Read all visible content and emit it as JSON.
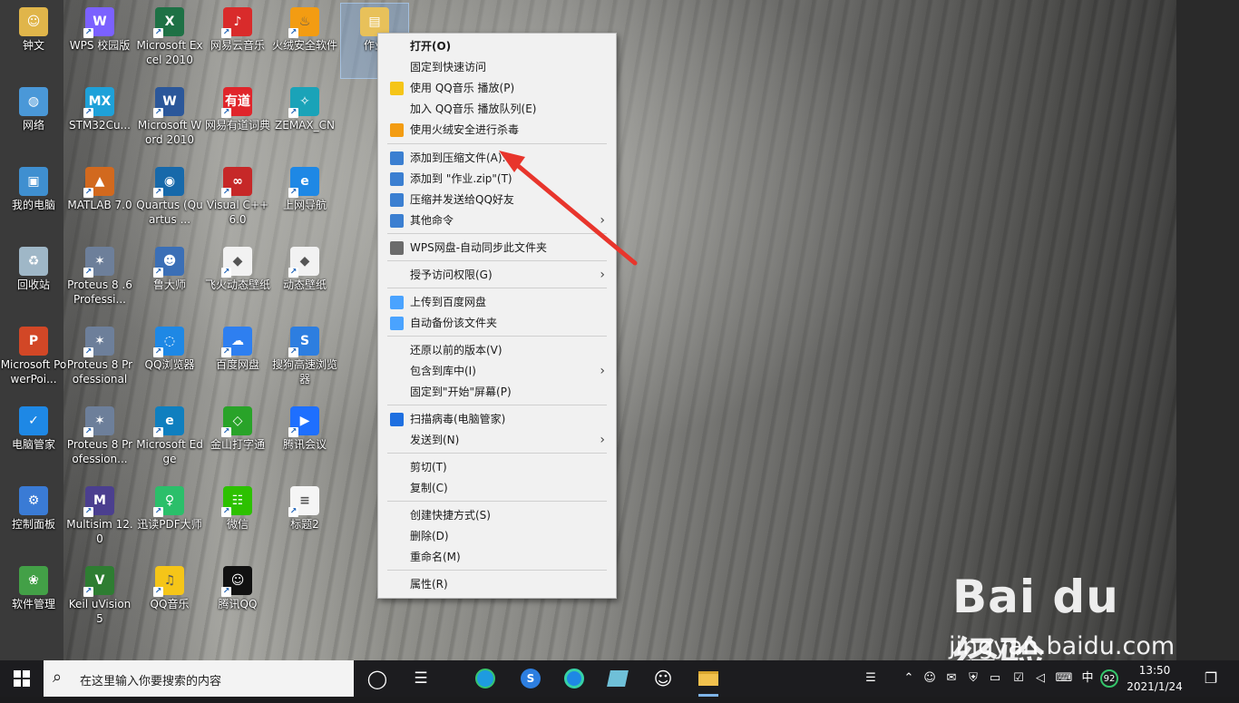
{
  "desktop_icons": [
    {
      "label": "钟文",
      "glyph": "☺",
      "color": "#e0b54a"
    },
    {
      "label": "网络",
      "glyph": "◍",
      "color": "#4a98d8"
    },
    {
      "label": "我的电脑",
      "glyph": "▣",
      "color": "#3f8fd0"
    },
    {
      "label": "回收站",
      "glyph": "♻",
      "color": "#9fb7c7"
    },
    {
      "label": "Microsoft PowerPoi...",
      "glyph": "P",
      "color": "#d24726"
    },
    {
      "label": "电脑管家",
      "glyph": "✓",
      "color": "#1e88e5"
    },
    {
      "label": "控制面板",
      "glyph": "⚙",
      "color": "#3a7bd5"
    },
    {
      "label": "软件管理",
      "glyph": "❀",
      "color": "#43a047"
    },
    {
      "label": "WPS 校园版",
      "glyph": "W",
      "color": "#7b61ff"
    },
    {
      "label": "STM32Cu...",
      "glyph": "MX",
      "color": "#1ea1d9"
    },
    {
      "label": "MATLAB 7.0",
      "glyph": "▲",
      "color": "#d2691e"
    },
    {
      "label": "Proteus 8 .6Professi...",
      "glyph": "✶",
      "color": "#6d7f9a"
    },
    {
      "label": "Proteus 8 Professional",
      "glyph": "✶",
      "color": "#6d7f9a"
    },
    {
      "label": "Proteus 8 Profession...",
      "glyph": "✶",
      "color": "#6d7f9a"
    },
    {
      "label": "Multisim 12.0",
      "glyph": "M",
      "color": "#4b3f8f"
    },
    {
      "label": "Keil uVision5",
      "glyph": "V",
      "color": "#2e7d32"
    },
    {
      "label": "Microsoft Excel 2010",
      "glyph": "X",
      "color": "#1e7145"
    },
    {
      "label": "Microsoft Word 2010",
      "glyph": "W",
      "color": "#2b579a"
    },
    {
      "label": "Quartus (Quartus ...",
      "glyph": "◉",
      "color": "#1769aa"
    },
    {
      "label": "鲁大师",
      "glyph": "☻",
      "color": "#3b6fb6"
    },
    {
      "label": "QQ浏览器",
      "glyph": "◌",
      "color": "#1e88e5"
    },
    {
      "label": "Microsoft Edge",
      "glyph": "e",
      "color": "#0f7fbf"
    },
    {
      "label": "迅读PDF大师",
      "glyph": "♀",
      "color": "#2bbf6a"
    },
    {
      "label": "QQ音乐",
      "glyph": "♫",
      "color": "#f5c518"
    },
    {
      "label": "网易云音乐",
      "glyph": "♪",
      "color": "#d92b2b"
    },
    {
      "label": "网易有道词典",
      "glyph": "有道",
      "color": "#e0252b"
    },
    {
      "label": "Visual C++ 6.0",
      "glyph": "∞",
      "color": "#c62828"
    },
    {
      "label": "飞火动态壁纸",
      "glyph": "◆",
      "color": "#f2f2f2"
    },
    {
      "label": "百度网盘",
      "glyph": "☁",
      "color": "#2e7ff0"
    },
    {
      "label": "金山打字通",
      "glyph": "◇",
      "color": "#29a329"
    },
    {
      "label": "微信",
      "glyph": "☷",
      "color": "#2dc100"
    },
    {
      "label": "腾讯QQ",
      "glyph": "☺",
      "color": "#111111"
    },
    {
      "label": "火绒安全软件",
      "glyph": "♨",
      "color": "#f39c12"
    },
    {
      "label": "ZEMAX_CN",
      "glyph": "✧",
      "color": "#1aa3b8"
    },
    {
      "label": "上网导航",
      "glyph": "e",
      "color": "#1e88e5"
    },
    {
      "label": "动态壁纸",
      "glyph": "◆",
      "color": "#f2f2f2"
    },
    {
      "label": "搜狗高速浏览器",
      "glyph": "S",
      "color": "#2d7ee0"
    },
    {
      "label": "腾讯会议",
      "glyph": "▶",
      "color": "#1e6fff"
    },
    {
      "label": "标题2",
      "glyph": "≡",
      "color": "#f5f5f5"
    },
    {
      "label": "作业",
      "glyph": "▤",
      "color": "#e8c15a"
    }
  ],
  "context_menu": {
    "items": [
      {
        "label": "打开(O)",
        "bold": true,
        "icon": "",
        "submenu": false
      },
      {
        "label": "固定到快速访问",
        "icon": "",
        "submenu": false
      },
      {
        "label": "使用 QQ音乐 播放(P)",
        "icon": "qq-music-icon",
        "icon_color": "#f5c518",
        "submenu": false
      },
      {
        "label": "加入 QQ音乐 播放队列(E)",
        "icon": "",
        "submenu": false
      },
      {
        "label": "使用火绒安全进行杀毒",
        "icon": "huorong-icon",
        "icon_color": "#f39c12",
        "submenu": false
      },
      {
        "label": "添加到压缩文件(A)...",
        "icon": "archive-icon",
        "icon_color": "#3b7fd1",
        "submenu": false
      },
      {
        "label": "添加到 \"作业.zip\"(T)",
        "icon": "archive-icon",
        "icon_color": "#3b7fd1",
        "submenu": false
      },
      {
        "label": "压缩并发送给QQ好友",
        "icon": "archive-icon",
        "icon_color": "#3b7fd1",
        "submenu": false
      },
      {
        "label": "其他命令",
        "icon": "archive-icon",
        "icon_color": "#3b7fd1",
        "submenu": true
      },
      {
        "label": "WPS网盘-自动同步此文件夹",
        "icon": "wps-cloud-icon",
        "icon_color": "#6b6b6b",
        "submenu": false
      },
      {
        "label": "授予访问权限(G)",
        "icon": "",
        "submenu": true
      },
      {
        "label": "上传到百度网盘",
        "icon": "baidu-cloud-icon",
        "icon_color": "#4aa3ff",
        "submenu": false
      },
      {
        "label": "自动备份该文件夹",
        "icon": "baidu-cloud-icon",
        "icon_color": "#4aa3ff",
        "submenu": false
      },
      {
        "label": "还原以前的版本(V)",
        "icon": "",
        "submenu": false
      },
      {
        "label": "包含到库中(I)",
        "icon": "",
        "submenu": true
      },
      {
        "label": "固定到\"开始\"屏幕(P)",
        "icon": "",
        "submenu": false
      },
      {
        "label": "扫描病毒(电脑管家)",
        "icon": "tencent-guard-icon",
        "icon_color": "#1e6fe0",
        "submenu": false
      },
      {
        "label": "发送到(N)",
        "icon": "",
        "submenu": true
      },
      {
        "label": "剪切(T)",
        "icon": "",
        "submenu": false
      },
      {
        "label": "复制(C)",
        "icon": "",
        "submenu": false
      },
      {
        "label": "创建快捷方式(S)",
        "icon": "",
        "submenu": false
      },
      {
        "label": "删除(D)",
        "icon": "",
        "submenu": false
      },
      {
        "label": "重命名(M)",
        "icon": "",
        "submenu": false
      },
      {
        "label": "属性(R)",
        "icon": "",
        "submenu": false
      }
    ]
  },
  "annotation": {
    "color": "#e8352c"
  },
  "watermark": {
    "logo": "Bai du 经验",
    "url": "jingyan.baidu.com"
  },
  "taskbar": {
    "search_placeholder": "在这里输入你要搜索的内容",
    "ime": "中",
    "badge": "92",
    "time": "13:50",
    "date": "2021/1/24"
  }
}
